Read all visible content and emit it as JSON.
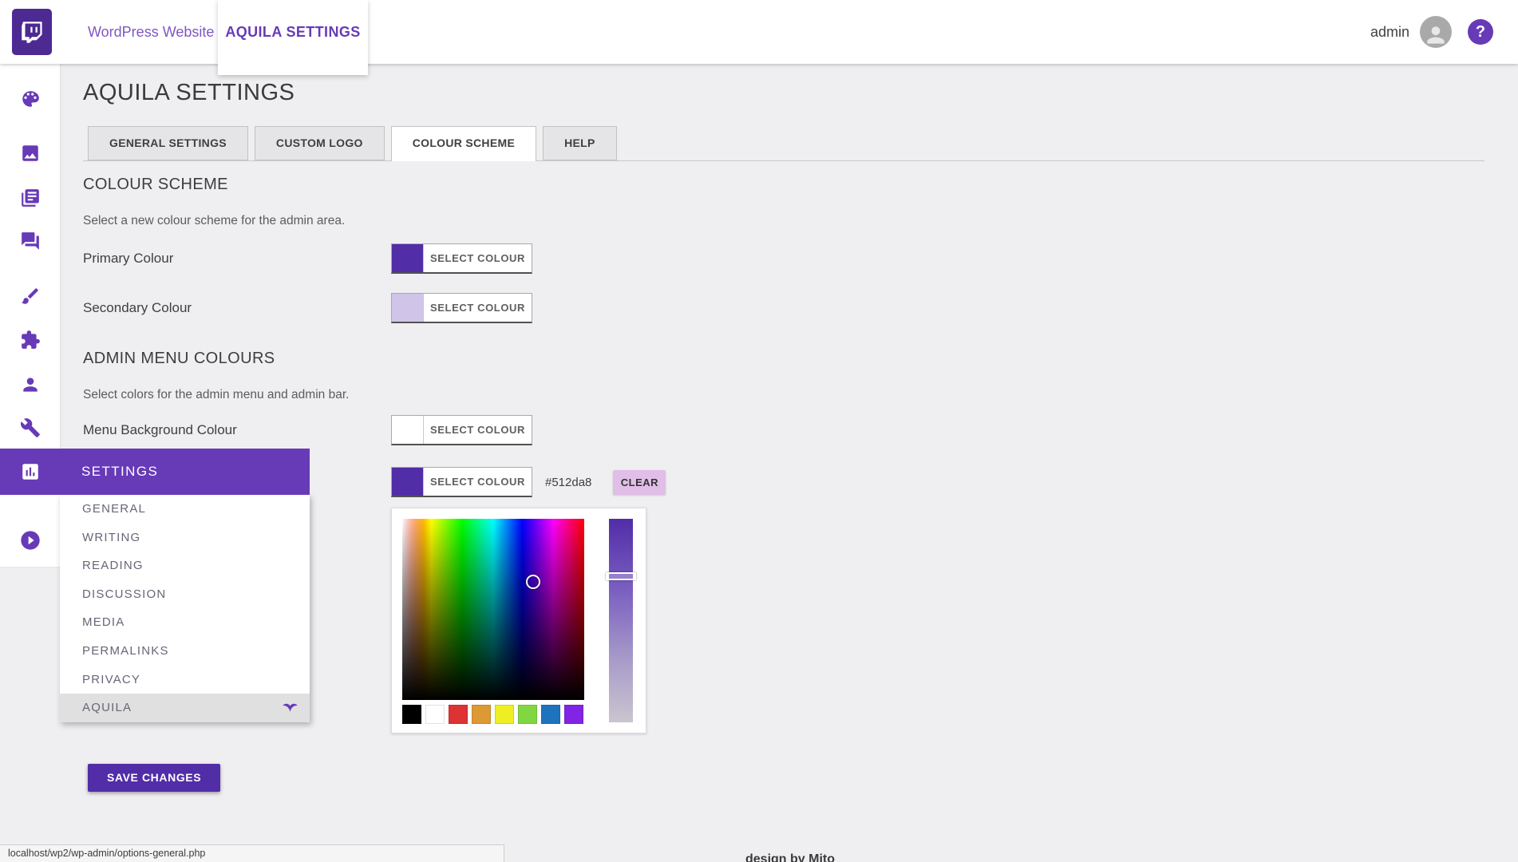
{
  "header": {
    "site_link": "WordPress Website",
    "active_menu": "AQUILA SETTINGS",
    "username": "admin",
    "help_label": "?"
  },
  "sidebar": {
    "icons": [
      "dashboard",
      "media",
      "pages",
      "comments",
      "appearance",
      "plugins",
      "users",
      "tools",
      "settings",
      "collapse"
    ],
    "settings_label": "SETTINGS",
    "submenu": [
      {
        "label": "GENERAL",
        "active": false
      },
      {
        "label": "WRITING",
        "active": false
      },
      {
        "label": "READING",
        "active": false
      },
      {
        "label": "DISCUSSION",
        "active": false
      },
      {
        "label": "MEDIA",
        "active": false
      },
      {
        "label": "PERMALINKS",
        "active": false
      },
      {
        "label": "PRIVACY",
        "active": false
      },
      {
        "label": "AQUILA",
        "active": true
      }
    ]
  },
  "page": {
    "title": "AQUILA SETTINGS",
    "tabs": [
      {
        "label": "GENERAL SETTINGS",
        "active": false
      },
      {
        "label": "CUSTOM LOGO",
        "active": false
      },
      {
        "label": "COLOUR SCHEME",
        "active": true
      },
      {
        "label": "HELP",
        "active": false
      }
    ],
    "colour_scheme": {
      "heading": "COLOUR SCHEME",
      "description": "Select a new colour scheme for the admin area.",
      "fields": [
        {
          "label": "Primary Colour",
          "swatch": "#512da8",
          "button": "SELECT COLOUR"
        },
        {
          "label": "Secondary Colour",
          "swatch": "#d1c4e9",
          "button": "SELECT COLOUR"
        }
      ]
    },
    "admin_menu_colours": {
      "heading": "ADMIN MENU COLOURS",
      "description": "Select colors for the admin menu and admin bar.",
      "fields": [
        {
          "label": "Menu Background Colour",
          "swatch": "#ffffff",
          "button": "SELECT COLOUR"
        }
      ],
      "open_field": {
        "swatch": "#512da8",
        "button": "SELECT COLOUR",
        "hex": "#512da8",
        "clear": "CLEAR"
      }
    },
    "picker": {
      "palette": [
        "#000000",
        "#ffffff",
        "#dd3333",
        "#dd9933",
        "#eeee22",
        "#81d742",
        "#1e73be",
        "#8224e3"
      ],
      "slider_color": "#512da8"
    },
    "save_button": "SAVE CHANGES"
  },
  "footer": {
    "status_url": "localhost/wp2/wp-admin/options-general.php",
    "credit": "design by Mito"
  },
  "colors": {
    "accent": "#673ab7",
    "primary": "#512da8",
    "secondary": "#d1c4e9",
    "clear_button_bg": "#e1bee7"
  }
}
